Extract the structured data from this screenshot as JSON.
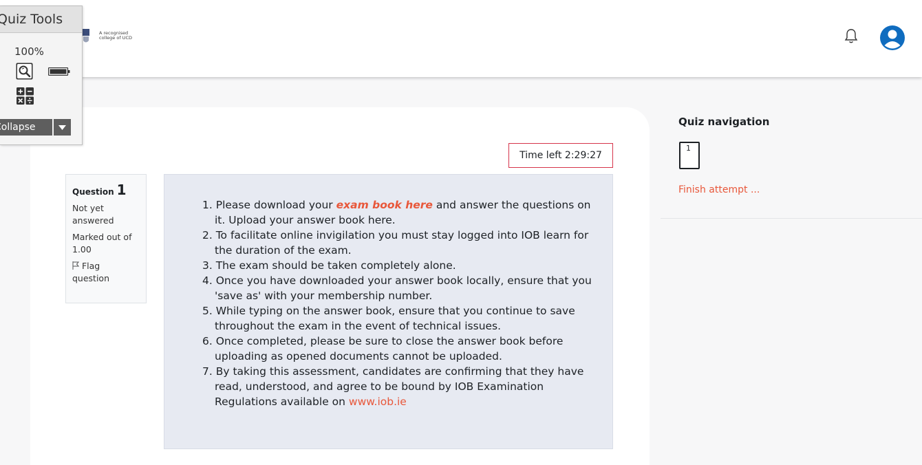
{
  "header": {
    "logo_text": "A recognised\ncollege of UCD",
    "icons": [
      "bell-icon",
      "user-avatar-icon"
    ]
  },
  "quiz_tools": {
    "title": "Quiz Tools",
    "zoom": "100%",
    "collapse_label": "Collapse",
    "icons": [
      "magnifier-icon",
      "battery-icon",
      "calculator-icon",
      "chevron-down-icon"
    ]
  },
  "timer": {
    "label": "Time left 2:29:27"
  },
  "question": {
    "label": "Question",
    "number": "1",
    "status": "Not yet answered",
    "marks": "Marked out of 1.00",
    "flag_label": "Flag question"
  },
  "instructions": {
    "item1_pre": "1. Please download your ",
    "item1_link": "exam book here",
    "item1_post": " and answer the questions on it.  Upload your answer book here.",
    "item2": "2. To facilitate online invigilation you must stay logged into IOB learn for the duration of the exam.",
    "item3": "3. The exam should be taken completely alone.",
    "item4": "4. Once you have downloaded your answer book locally, ensure that you 'save as' with your membership number.",
    "item5": "5. While typing on the answer book, ensure that you continue to save throughout the exam in the event of technical issues.",
    "item6": "6. Once completed, please be sure to close the answer book before uploading as opened documents cannot be uploaded.",
    "item7_pre": "7. By taking this assessment, candidates are confirming that they have read, understood, and agree to be bound by IOB Examination Regulations available on ",
    "item7_link": "www.iob.ie"
  },
  "quiz_nav": {
    "title": "Quiz navigation",
    "question_button": "1",
    "finish_link": "Finish attempt ..."
  },
  "colors": {
    "accent": "#e8573a",
    "timer_border": "#d6334a",
    "avatar": "#0f6cbf",
    "question_bg": "#e7eaf2"
  }
}
